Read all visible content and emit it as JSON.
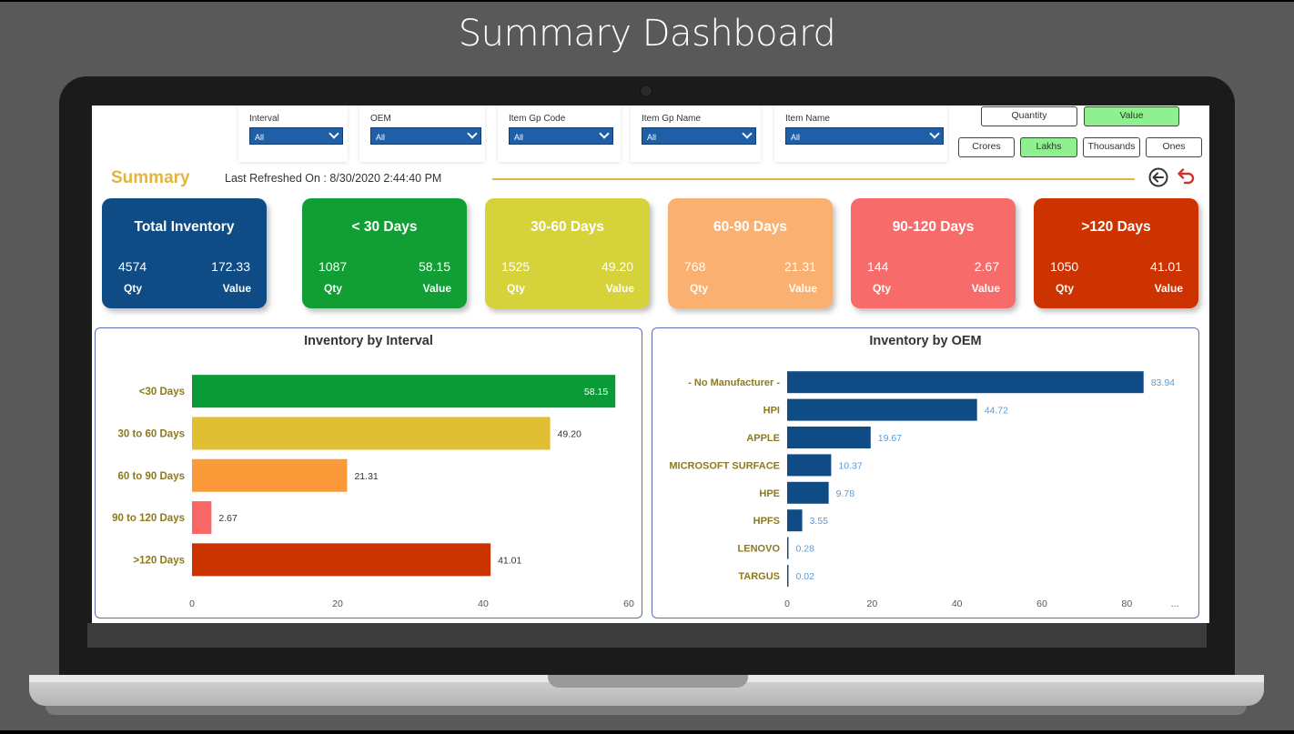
{
  "page_title": "Summary Dashboard",
  "filters": [
    {
      "label": "Interval",
      "value": "All"
    },
    {
      "label": "OEM",
      "value": "All"
    },
    {
      "label": "Item Gp Code",
      "value": "All"
    },
    {
      "label": "Item Gp Name",
      "value": "All"
    },
    {
      "label": "Item Name",
      "value": "All"
    }
  ],
  "measure_toggles": [
    {
      "label": "Quantity",
      "selected": false
    },
    {
      "label": "Value",
      "selected": true
    }
  ],
  "unit_toggles": [
    {
      "label": "Crores",
      "selected": false
    },
    {
      "label": "Lakhs",
      "selected": true
    },
    {
      "label": "Thousands",
      "selected": false
    },
    {
      "label": "Ones",
      "selected": false
    }
  ],
  "summary": {
    "title": "Summary",
    "refresh": "Last Refreshed On : 8/30/2020 2:44:40 PM",
    "accent": "#e3b53a"
  },
  "icons": {
    "back": "back-arrow-icon",
    "undo": "undo-icon"
  },
  "cards": [
    {
      "title": "Total Inventory",
      "qty": "4574",
      "value": "172.33",
      "qty_label": "Qty",
      "value_label": "Value",
      "color": "#0f4c86"
    },
    {
      "title": "< 30 Days",
      "qty": "1087",
      "value": "58.15",
      "qty_label": "Qty",
      "value_label": "Value",
      "color": "#109e35"
    },
    {
      "title": "30-60 Days",
      "qty": "1525",
      "value": "49.20",
      "qty_label": "Qty",
      "value_label": "Value",
      "color": "#d6d23a"
    },
    {
      "title": "60-90 Days",
      "qty": "768",
      "value": "21.31",
      "qty_label": "Qty",
      "value_label": "Value",
      "color": "#f9b070"
    },
    {
      "title": "90-120 Days",
      "qty": "144",
      "value": "2.67",
      "qty_label": "Qty",
      "value_label": "Value",
      "color": "#f76b6b"
    },
    {
      "title": ">120 Days",
      "qty": "1050",
      "value": "41.01",
      "qty_label": "Qty",
      "value_label": "Value",
      "color": "#cc3300"
    }
  ],
  "chart_data": [
    {
      "type": "bar",
      "orientation": "horizontal",
      "title": "Inventory by Interval",
      "categories": [
        "<30 Days",
        "30 to 60 Days",
        "60 to 90 Days",
        "90 to 120 Days",
        ">120 Days"
      ],
      "values": [
        58.15,
        49.2,
        21.31,
        2.67,
        41.01
      ],
      "value_labels": [
        "58.15",
        "49.20",
        "21.31",
        "2.67",
        "41.01"
      ],
      "colors": [
        "#0a9a37",
        "#e0c032",
        "#fb9a38",
        "#f96666",
        "#c83300"
      ],
      "xlim": [
        0,
        60
      ],
      "xticks": [
        "0",
        "20",
        "40",
        "60"
      ],
      "label_color": "#8c7a1e"
    },
    {
      "type": "bar",
      "orientation": "horizontal",
      "title": "Inventory by OEM",
      "categories": [
        "- No Manufacturer -",
        "HPI",
        "APPLE",
        "MICROSOFT SURFACE",
        "HPE",
        "HPFS",
        "LENOVO",
        "TARGUS"
      ],
      "values": [
        83.94,
        44.72,
        19.67,
        10.37,
        9.78,
        3.55,
        0.28,
        0.02
      ],
      "value_labels": [
        "83.94",
        "44.72",
        "19.67",
        "10.37",
        "9.78",
        "3.55",
        "0.28",
        "0.02"
      ],
      "colors": [
        "#0f4c86"
      ],
      "xlim": [
        0,
        90
      ],
      "xticks": [
        "0",
        "20",
        "40",
        "60",
        "80",
        "..."
      ],
      "label_color": "#8c7a1e",
      "value_label_color": "#5b9bd5"
    }
  ]
}
